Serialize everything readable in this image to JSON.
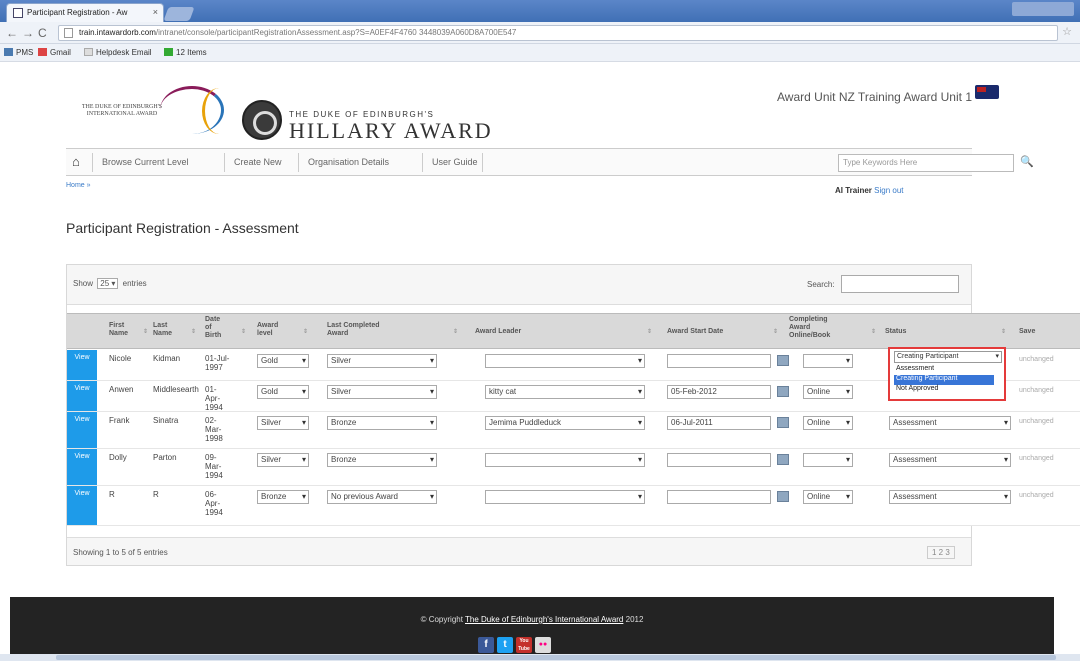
{
  "browser": {
    "tab_title": "Participant Registration - Aw",
    "tab_close": "×",
    "url_host": "train.intawardorb.com",
    "url_path": "/intranet/console/participantRegistrationAssessment.asp?S=A0EF4F4760 3448039A060D8A700E547",
    "bookmarks": [
      "PMS",
      "Gmail",
      "Helpdesk Email",
      "12 Items"
    ]
  },
  "header": {
    "intl_logo_text": "THE DUKE OF EDINBURGH'S INTERNATIONAL AWARD",
    "brand_small": "THE DUKE OF EDINBURGH'S",
    "brand_big": "HILLARY AWARD",
    "unit_name": "Award Unit NZ Training Award Unit 1"
  },
  "menu": {
    "items": [
      "Browse Current Level",
      "Create New",
      "Organisation Details",
      "User Guide"
    ],
    "search_placeholder": "Type Keywords Here"
  },
  "breadcrumb": "Home »",
  "trainer": {
    "name": "AI Trainer",
    "signout": "Sign out"
  },
  "page_title": "Participant Registration - Assessment",
  "table": {
    "show_label": "Show",
    "page_size": "25",
    "entries_label": "entries",
    "search_label": "Search:",
    "headers": {
      "first_name": "First Name",
      "last_name": "Last Name",
      "dob": "Date of Birth",
      "award_level": "Award level",
      "last_completed": "Last Completed Award",
      "award_leader": "Award Leader",
      "award_start": "Award Start Date",
      "completing": "Completing Award Online/Book",
      "status": "Status",
      "save": "Save"
    },
    "view_label": "View",
    "rows": [
      {
        "first": "Nicole",
        "last": "Kidman",
        "dob": "01-Jul-1997",
        "level": "Gold",
        "last_award": "Silver",
        "leader": "",
        "start": "",
        "mode": "",
        "status": "Creating Participant",
        "save": "unchanged"
      },
      {
        "first": "Anwen",
        "last": "Middlesearth",
        "dob": "01-Apr-1994",
        "level": "Gold",
        "last_award": "Silver",
        "leader": "kitty cat",
        "start": "05-Feb-2012",
        "mode": "Online",
        "status": "",
        "save": "unchanged"
      },
      {
        "first": "Frank",
        "last": "Sinatra",
        "dob": "02-Mar-1998",
        "level": "Silver",
        "last_award": "Bronze",
        "leader": "Jemima Puddleduck",
        "start": "06-Jul-2011",
        "mode": "Online",
        "status": "Assessment",
        "save": "unchanged"
      },
      {
        "first": "Dolly",
        "last": "Parton",
        "dob": "09-Mar-1994",
        "level": "Silver",
        "last_award": "Bronze",
        "leader": "",
        "start": "",
        "mode": "",
        "status": "Assessment",
        "save": "unchanged"
      },
      {
        "first": "R",
        "last": "R",
        "dob": "06-Apr-1994",
        "level": "Bronze",
        "last_award": "No previous Award",
        "leader": "",
        "start": "",
        "mode": "Online",
        "status": "Assessment",
        "save": "unchanged"
      }
    ],
    "status_options": [
      "Assessment",
      "Creating Participant",
      "Not Approved"
    ],
    "status_highlighted": "Creating Participant",
    "showing": "Showing 1 to 5 of 5 entries",
    "pager": "1 2 3"
  },
  "footer": {
    "copyright_prefix": "© Copyright",
    "copyright_link": "The Duke of Edinburgh's International Award",
    "copyright_year": "2012",
    "social": [
      "f",
      "t",
      "You Tube",
      "●●"
    ]
  }
}
